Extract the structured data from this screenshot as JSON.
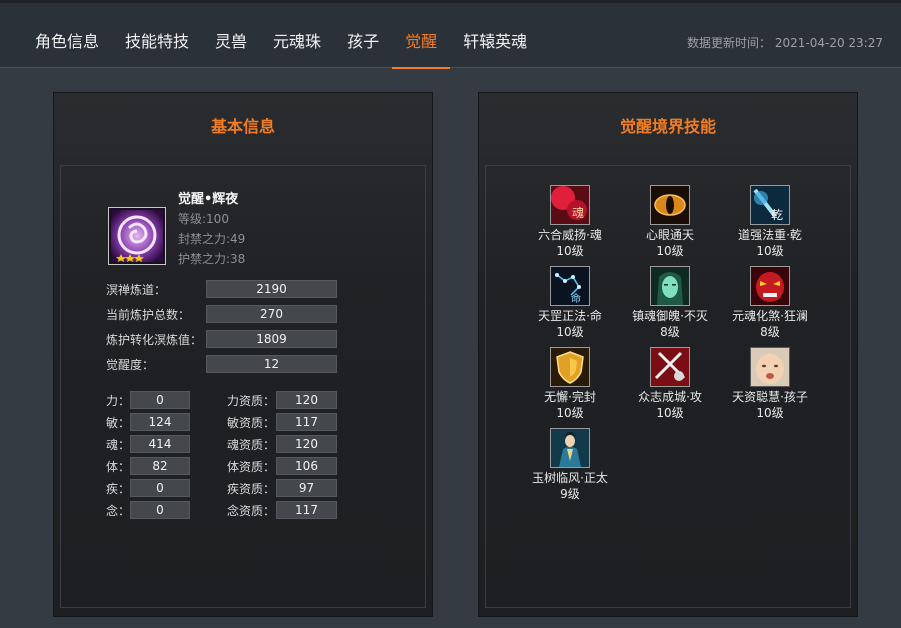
{
  "tabs": [
    "角色信息",
    "技能特技",
    "灵兽",
    "元魂珠",
    "孩子",
    "觉醒",
    "轩辕英魂"
  ],
  "active_tab": "觉醒",
  "update_time": "数据更新时间： 2021-04-20 23:27",
  "left_panel": {
    "title": "基本信息",
    "character": {
      "name": "觉醒•辉夜",
      "level": "等级:100",
      "seal_power": "封禁之力:49",
      "guard_power": "护禁之力:38",
      "stars": 3,
      "icon": "awakening-portrait-icon"
    },
    "stats": [
      {
        "label": "溟禅炼道：",
        "value": "2190"
      },
      {
        "label": "当前炼护总数：",
        "value": "270"
      },
      {
        "label": "炼护转化溟炼值：",
        "value": "1809"
      },
      {
        "label": "觉醒度：",
        "value": "12"
      }
    ],
    "attributes": [
      {
        "label": "力：",
        "value": "0",
        "apt_label": "力资质：",
        "apt_value": "120"
      },
      {
        "label": "敏：",
        "value": "124",
        "apt_label": "敏资质：",
        "apt_value": "117"
      },
      {
        "label": "魂：",
        "value": "414",
        "apt_label": "魂资质：",
        "apt_value": "120"
      },
      {
        "label": "体：",
        "value": "82",
        "apt_label": "体资质：",
        "apt_value": "106"
      },
      {
        "label": "疾：",
        "value": "0",
        "apt_label": "疾资质：",
        "apt_value": "97"
      },
      {
        "label": "念：",
        "value": "0",
        "apt_label": "念资质：",
        "apt_value": "117"
      }
    ]
  },
  "right_panel": {
    "title": "觉醒境界技能",
    "skills": [
      {
        "name": "六合威扬·魂",
        "level": "10级",
        "icon": "red-soul-rune-icon"
      },
      {
        "name": "心眼通天",
        "level": "10级",
        "icon": "golden-eye-icon"
      },
      {
        "name": "道强法重·乾",
        "level": "10级",
        "icon": "blue-sword-rune-icon"
      },
      {
        "name": "天罡正法·命",
        "level": "10级",
        "icon": "constellation-icon"
      },
      {
        "name": "镇魂御魄·不灭",
        "level": "8级",
        "icon": "green-spirit-face-icon"
      },
      {
        "name": "元魂化煞·狂澜",
        "level": "8级",
        "icon": "red-demon-mask-icon"
      },
      {
        "name": "无懈·完封",
        "level": "10级",
        "icon": "golden-shield-icon"
      },
      {
        "name": "众志成城·攻",
        "level": "10级",
        "icon": "crossed-swords-icon"
      },
      {
        "name": "天资聪慧·孩子",
        "level": "10级",
        "icon": "baby-face-icon"
      },
      {
        "name": "玉树临风·正太",
        "level": "9级",
        "icon": "young-swordsman-icon"
      }
    ]
  },
  "colors": {
    "accent": "#f07d24",
    "background": "#353b43",
    "panel": "#1f2124"
  }
}
